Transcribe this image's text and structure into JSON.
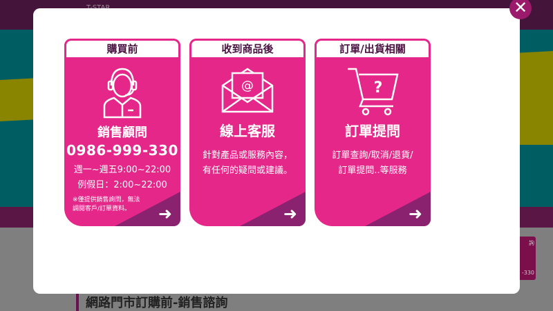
{
  "background": {
    "brand": "T-STAR",
    "heading": "網路門市訂購前-銷售諮詢",
    "widget_title": "詢",
    "widget_phone": "-330"
  },
  "modal": {
    "close_label": "✕",
    "cards": [
      {
        "header": "購買前",
        "icon": "customer-service-headset-icon",
        "title": "銷售顧問",
        "phone": "0986-999-330",
        "hours": [
          "週一~週五9:00~22:00",
          "例假日：2:00~22:00"
        ],
        "note": [
          "※僅提供銷售詢問，無法",
          "調閱客戶/訂單資料。"
        ]
      },
      {
        "header": "收到商品後",
        "icon": "email-envelope-icon",
        "title": "線上客服",
        "desc": [
          "針對產品或服務內容，",
          "有任何的疑問或建議。"
        ]
      },
      {
        "header": "訂單/出貨相關",
        "icon": "shopping-cart-question-icon",
        "title": "訂單提問",
        "desc": [
          "訂單查詢/取消/退貨/",
          "訂單提問..等服務"
        ]
      }
    ],
    "arrow": "➜"
  },
  "colors": {
    "card": "#e5278a",
    "accent": "#8b2270",
    "header_text": "#4a1240"
  }
}
